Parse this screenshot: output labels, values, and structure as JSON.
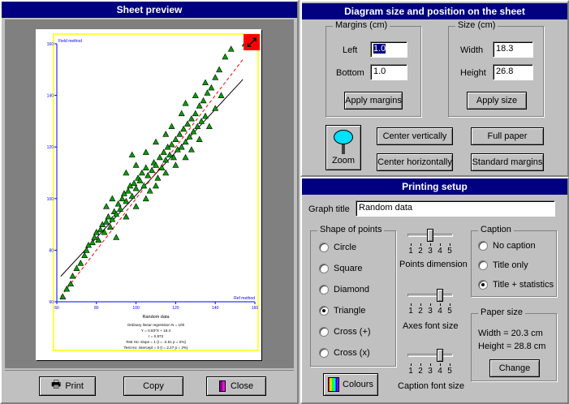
{
  "preview": {
    "title": "Sheet preview",
    "y_axis_label": "Field method",
    "x_axis_label": "Ref method",
    "y_ticks": [
      "160",
      "140",
      "120",
      "100",
      "80",
      "60"
    ],
    "x_ticks": [
      "60",
      "80",
      "100",
      "120",
      "140",
      "160"
    ],
    "graph_title": "Random data",
    "stats_lines": [
      "Ordinary linear regression  N = 100",
      "Y = 0.83*X + 18.4",
      "r = 0.872",
      "Test Ho: slope = 1  (t = -2.51 p = 2%)",
      "Test Ho: intercept = 0  (t = 2.27 p = 2%)"
    ]
  },
  "diagram": {
    "title": "Diagram size and position on the sheet",
    "margins_label": "Margins (cm)",
    "left_label": "Left",
    "left_value": "1.0",
    "bottom_label": "Bottom",
    "bottom_value": "1.0",
    "apply_margins": "Apply margins",
    "size_label": "Size (cm)",
    "width_label": "Width",
    "width_value": "18.3",
    "height_label": "Height",
    "height_value": "26.8",
    "apply_size": "Apply size",
    "zoom": "Zoom",
    "center_vertically": "Center vertically",
    "center_horizontally": "Center horizontally",
    "full_paper": "Full paper",
    "standard_margins": "Standard margins"
  },
  "printing": {
    "title": "Printing setup",
    "graph_title_label": "Graph title",
    "graph_title_value": "Random data",
    "shape_label": "Shape of points",
    "shapes": [
      "Circle",
      "Square",
      "Diamond",
      "Triangle",
      "Cross (+)",
      "Cross (x)"
    ],
    "selected_shape": "Triangle",
    "points_dimension_label": "Points dimension",
    "points_dimension_value": 3,
    "axes_font_label": "Axes font size",
    "axes_font_value": 4,
    "caption_font_label": "Caption font size",
    "caption_font_value": 4,
    "slider_ticks": [
      "1",
      "2",
      "3",
      "4",
      "5"
    ],
    "caption_label": "Caption",
    "caption_options": [
      "No caption",
      "Title only",
      "Title + statistics"
    ],
    "selected_caption": "Title + statistics",
    "paper_label": "Paper size",
    "paper_width": "Width = 20.3 cm",
    "paper_height": "Height = 28.8 cm",
    "change": "Change",
    "colours": "Colours"
  },
  "footer": {
    "print": "Print",
    "copy": "Copy",
    "close": "Close"
  },
  "chart_data": {
    "type": "scatter",
    "xlim": [
      60,
      160
    ],
    "ylim": [
      60,
      160
    ],
    "marker": "triangle",
    "marker_color": "#00a000",
    "lines": [
      {
        "name": "regression",
        "style": "solid",
        "slope": 0.83,
        "intercept": 18.4
      },
      {
        "name": "identity",
        "style": "dashed",
        "color": "#ff0000",
        "slope": 1,
        "intercept": 0
      }
    ],
    "points": [
      [
        63,
        62
      ],
      [
        65,
        65
      ],
      [
        67,
        67
      ],
      [
        68,
        70
      ],
      [
        70,
        73
      ],
      [
        72,
        75
      ],
      [
        74,
        78
      ],
      [
        75,
        80
      ],
      [
        76,
        82
      ],
      [
        78,
        83
      ],
      [
        79,
        85
      ],
      [
        80,
        87
      ],
      [
        81,
        84
      ],
      [
        82,
        88
      ],
      [
        83,
        90
      ],
      [
        84,
        87
      ],
      [
        85,
        91
      ],
      [
        86,
        93
      ],
      [
        87,
        89
      ],
      [
        88,
        92
      ],
      [
        89,
        95
      ],
      [
        90,
        94
      ],
      [
        91,
        98
      ],
      [
        92,
        96
      ],
      [
        93,
        100
      ],
      [
        94,
        102
      ],
      [
        95,
        99
      ],
      [
        96,
        103
      ],
      [
        97,
        105
      ],
      [
        98,
        101
      ],
      [
        99,
        106
      ],
      [
        100,
        104
      ],
      [
        101,
        108
      ],
      [
        102,
        107
      ],
      [
        103,
        110
      ],
      [
        104,
        105
      ],
      [
        105,
        112
      ],
      [
        106,
        109
      ],
      [
        107,
        103
      ],
      [
        108,
        111
      ],
      [
        109,
        114
      ],
      [
        110,
        113
      ],
      [
        111,
        108
      ],
      [
        112,
        116
      ],
      [
        113,
        112
      ],
      [
        114,
        118
      ],
      [
        115,
        115
      ],
      [
        116,
        120
      ],
      [
        117,
        117
      ],
      [
        118,
        121
      ],
      [
        119,
        116
      ],
      [
        120,
        123
      ],
      [
        121,
        119
      ],
      [
        122,
        125
      ],
      [
        123,
        120
      ],
      [
        124,
        127
      ],
      [
        125,
        122
      ],
      [
        126,
        129
      ],
      [
        127,
        124
      ],
      [
        128,
        131
      ],
      [
        129,
        126
      ],
      [
        130,
        133
      ],
      [
        131,
        128
      ],
      [
        132,
        136
      ],
      [
        133,
        130
      ],
      [
        134,
        138
      ],
      [
        135,
        132
      ],
      [
        136,
        141
      ],
      [
        138,
        143
      ],
      [
        140,
        147
      ],
      [
        142,
        150
      ],
      [
        145,
        155
      ],
      [
        148,
        158
      ],
      [
        155,
        160
      ],
      [
        85,
        97
      ],
      [
        95,
        110
      ],
      [
        100,
        113
      ],
      [
        105,
        118
      ],
      [
        110,
        122
      ],
      [
        115,
        125
      ],
      [
        118,
        128
      ],
      [
        123,
        133
      ],
      [
        125,
        137
      ],
      [
        130,
        140
      ],
      [
        135,
        145
      ],
      [
        90,
        85
      ],
      [
        95,
        93
      ],
      [
        100,
        97
      ],
      [
        105,
        100
      ],
      [
        110,
        105
      ],
      [
        115,
        110
      ],
      [
        120,
        113
      ],
      [
        125,
        116
      ],
      [
        128,
        119
      ],
      [
        132,
        123
      ],
      [
        137,
        128
      ],
      [
        140,
        135
      ],
      [
        143,
        140
      ],
      [
        88,
        100
      ],
      [
        98,
        117
      ]
    ]
  }
}
